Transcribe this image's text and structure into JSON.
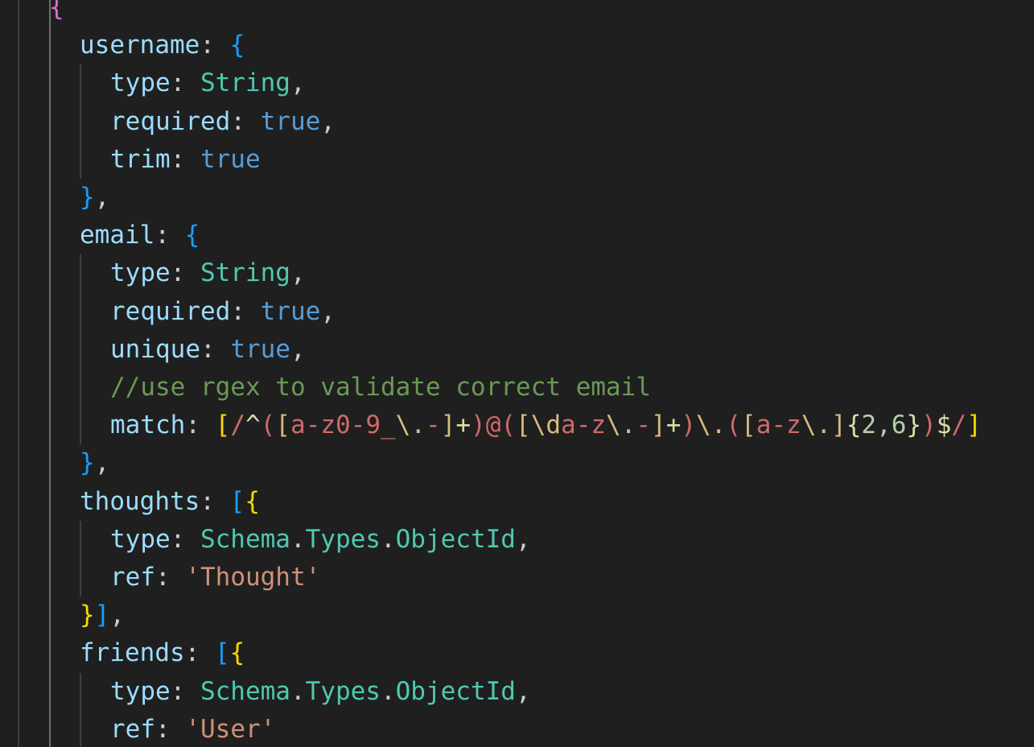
{
  "editor": {
    "colors": {
      "background": "#1f1f1f",
      "indent_guide": "#404040",
      "active_indent_guide": "#707070",
      "property": "#9cdcfe",
      "type": "#4ec9b0",
      "keyword": "#569cd6",
      "string": "#ce9178",
      "comment": "#6a9955",
      "bracket_gold": "#ffd700",
      "bracket_orchid": "#da70d6",
      "bracket_blue": "#179fff",
      "regex": "#d16969"
    },
    "lines": [
      {
        "indent": 1,
        "tokens": [
          {
            "t": "{",
            "c": "b2"
          }
        ]
      },
      {
        "indent": 2,
        "tokens": [
          {
            "t": "username",
            "c": "prop"
          },
          {
            "t": ": ",
            "c": "punc"
          },
          {
            "t": "{",
            "c": "b3"
          }
        ]
      },
      {
        "indent": 3,
        "tokens": [
          {
            "t": "type",
            "c": "prop"
          },
          {
            "t": ": ",
            "c": "punc"
          },
          {
            "t": "String",
            "c": "type"
          },
          {
            "t": ",",
            "c": "punc"
          }
        ]
      },
      {
        "indent": 3,
        "tokens": [
          {
            "t": "required",
            "c": "prop"
          },
          {
            "t": ": ",
            "c": "punc"
          },
          {
            "t": "true",
            "c": "kw"
          },
          {
            "t": ",",
            "c": "punc"
          }
        ]
      },
      {
        "indent": 3,
        "tokens": [
          {
            "t": "trim",
            "c": "prop"
          },
          {
            "t": ": ",
            "c": "punc"
          },
          {
            "t": "true",
            "c": "kw"
          }
        ]
      },
      {
        "indent": 2,
        "tokens": [
          {
            "t": "}",
            "c": "b3"
          },
          {
            "t": ",",
            "c": "punc"
          }
        ]
      },
      {
        "indent": 2,
        "tokens": [
          {
            "t": "email",
            "c": "prop"
          },
          {
            "t": ": ",
            "c": "punc"
          },
          {
            "t": "{",
            "c": "b3"
          }
        ]
      },
      {
        "indent": 3,
        "tokens": [
          {
            "t": "type",
            "c": "prop"
          },
          {
            "t": ": ",
            "c": "punc"
          },
          {
            "t": "String",
            "c": "type"
          },
          {
            "t": ",",
            "c": "punc"
          }
        ]
      },
      {
        "indent": 3,
        "tokens": [
          {
            "t": "required",
            "c": "prop"
          },
          {
            "t": ": ",
            "c": "punc"
          },
          {
            "t": "true",
            "c": "kw"
          },
          {
            "t": ",",
            "c": "punc"
          }
        ]
      },
      {
        "indent": 3,
        "tokens": [
          {
            "t": "unique",
            "c": "prop"
          },
          {
            "t": ": ",
            "c": "punc"
          },
          {
            "t": "true",
            "c": "kw"
          },
          {
            "t": ",",
            "c": "punc"
          }
        ]
      },
      {
        "indent": 3,
        "tokens": [
          {
            "t": "//use rgex to validate correct email",
            "c": "comment"
          }
        ]
      },
      {
        "indent": 3,
        "tokens": [
          {
            "t": "match",
            "c": "prop"
          },
          {
            "t": ": ",
            "c": "punc"
          },
          {
            "t": "[",
            "c": "b1"
          },
          {
            "t": "/",
            "c": "rx"
          },
          {
            "t": "^",
            "c": "rxop"
          },
          {
            "t": "(",
            "c": "rx"
          },
          {
            "t": "[",
            "c": "rxe"
          },
          {
            "t": "a-z0-9_",
            "c": "rx"
          },
          {
            "t": "\\.",
            "c": "rxe"
          },
          {
            "t": "-",
            "c": "rx"
          },
          {
            "t": "]",
            "c": "rxe"
          },
          {
            "t": "+",
            "c": "rxop"
          },
          {
            "t": ")",
            "c": "rx"
          },
          {
            "t": "@",
            "c": "rx"
          },
          {
            "t": "(",
            "c": "rx"
          },
          {
            "t": "[",
            "c": "rxe"
          },
          {
            "t": "\\d",
            "c": "rxe"
          },
          {
            "t": "a-z",
            "c": "rx"
          },
          {
            "t": "\\.",
            "c": "rxe"
          },
          {
            "t": "-",
            "c": "rx"
          },
          {
            "t": "]",
            "c": "rxe"
          },
          {
            "t": "+",
            "c": "rxop"
          },
          {
            "t": ")",
            "c": "rx"
          },
          {
            "t": "\\.",
            "c": "rxe"
          },
          {
            "t": "(",
            "c": "rx"
          },
          {
            "t": "[",
            "c": "rxe"
          },
          {
            "t": "a-z",
            "c": "rx"
          },
          {
            "t": "\\.",
            "c": "rxe"
          },
          {
            "t": "]",
            "c": "rxe"
          },
          {
            "t": "{",
            "c": "rxop"
          },
          {
            "t": "2,6",
            "c": "num"
          },
          {
            "t": "}",
            "c": "rxop"
          },
          {
            "t": ")",
            "c": "rx"
          },
          {
            "t": "$",
            "c": "rxop"
          },
          {
            "t": "/",
            "c": "rx"
          },
          {
            "t": "]",
            "c": "b1"
          }
        ]
      },
      {
        "indent": 2,
        "tokens": [
          {
            "t": "}",
            "c": "b3"
          },
          {
            "t": ",",
            "c": "punc"
          }
        ]
      },
      {
        "indent": 2,
        "tokens": [
          {
            "t": "thoughts",
            "c": "prop"
          },
          {
            "t": ": ",
            "c": "punc"
          },
          {
            "t": "[",
            "c": "b3"
          },
          {
            "t": "{",
            "c": "b1"
          }
        ]
      },
      {
        "indent": 3,
        "tokens": [
          {
            "t": "type",
            "c": "prop"
          },
          {
            "t": ": ",
            "c": "punc"
          },
          {
            "t": "Schema",
            "c": "type"
          },
          {
            "t": ".",
            "c": "punc"
          },
          {
            "t": "Types",
            "c": "type"
          },
          {
            "t": ".",
            "c": "punc"
          },
          {
            "t": "ObjectId",
            "c": "type"
          },
          {
            "t": ",",
            "c": "punc"
          }
        ]
      },
      {
        "indent": 3,
        "tokens": [
          {
            "t": "ref",
            "c": "prop"
          },
          {
            "t": ": ",
            "c": "punc"
          },
          {
            "t": "'Thought'",
            "c": "str"
          }
        ]
      },
      {
        "indent": 2,
        "tokens": [
          {
            "t": "}",
            "c": "b1"
          },
          {
            "t": "]",
            "c": "b3"
          },
          {
            "t": ",",
            "c": "punc"
          }
        ]
      },
      {
        "indent": 2,
        "tokens": [
          {
            "t": "friends",
            "c": "prop"
          },
          {
            "t": ": ",
            "c": "punc"
          },
          {
            "t": "[",
            "c": "b3"
          },
          {
            "t": "{",
            "c": "b1"
          }
        ]
      },
      {
        "indent": 3,
        "tokens": [
          {
            "t": "type",
            "c": "prop"
          },
          {
            "t": ": ",
            "c": "punc"
          },
          {
            "t": "Schema",
            "c": "type"
          },
          {
            "t": ".",
            "c": "punc"
          },
          {
            "t": "Types",
            "c": "type"
          },
          {
            "t": ".",
            "c": "punc"
          },
          {
            "t": "ObjectId",
            "c": "type"
          },
          {
            "t": ",",
            "c": "punc"
          }
        ]
      },
      {
        "indent": 3,
        "tokens": [
          {
            "t": "ref",
            "c": "prop"
          },
          {
            "t": ": ",
            "c": "punc"
          },
          {
            "t": "'User'",
            "c": "str"
          }
        ]
      }
    ]
  }
}
